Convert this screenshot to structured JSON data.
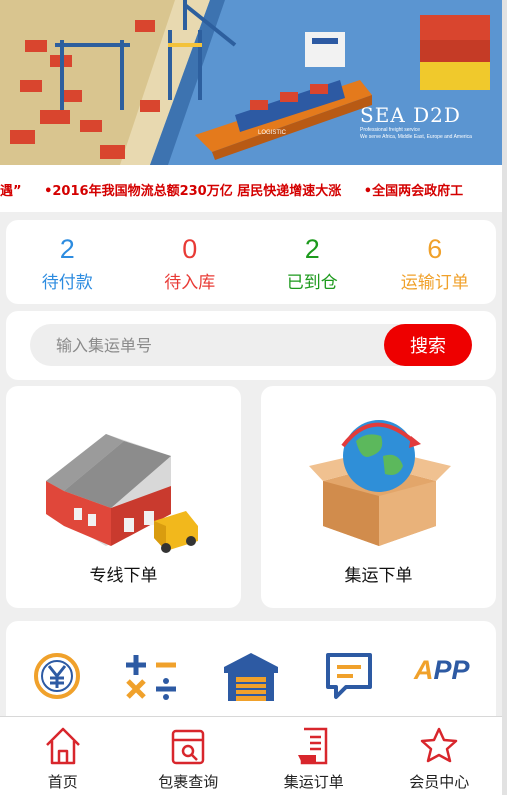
{
  "banner": {
    "brand": "SEA D2D",
    "subtitle_1": "Professional freight service",
    "subtitle_2": "We serve Africa, Middle East, Europe and America",
    "ship_text": "LOGISTIC"
  },
  "ticker": {
    "items": [
      "遇”",
      "•2016年我国物流总额230万亿 居民快递增速大涨",
      "•全国两会政府工"
    ]
  },
  "stats": [
    {
      "value": "2",
      "label": "待付款",
      "color": "#2d8ce0"
    },
    {
      "value": "0",
      "label": "待入库",
      "color": "#e83b36"
    },
    {
      "value": "2",
      "label": "已到仓",
      "color": "#1d9a1d"
    },
    {
      "value": "6",
      "label": "运输订单",
      "color": "#f0a12b"
    }
  ],
  "search": {
    "placeholder": "输入集运单号",
    "button_label": "搜索"
  },
  "orders": {
    "left_label": "专线下单",
    "right_label": "集运下单"
  },
  "tools": {
    "app_label": "APP",
    "icons": [
      "yuan-coin-icon",
      "calculator-icon",
      "warehouse-icon",
      "message-icon",
      "app-icon"
    ]
  },
  "tabbar": [
    {
      "label": "首页",
      "icon": "home-icon"
    },
    {
      "label": "包裹查询",
      "icon": "package-search-icon"
    },
    {
      "label": "集运订单",
      "icon": "order-doc-icon"
    },
    {
      "label": "会员中心",
      "icon": "star-icon"
    }
  ],
  "colors": {
    "accent_red": "#ee0000",
    "tab_icon_red": "#d8262c"
  }
}
